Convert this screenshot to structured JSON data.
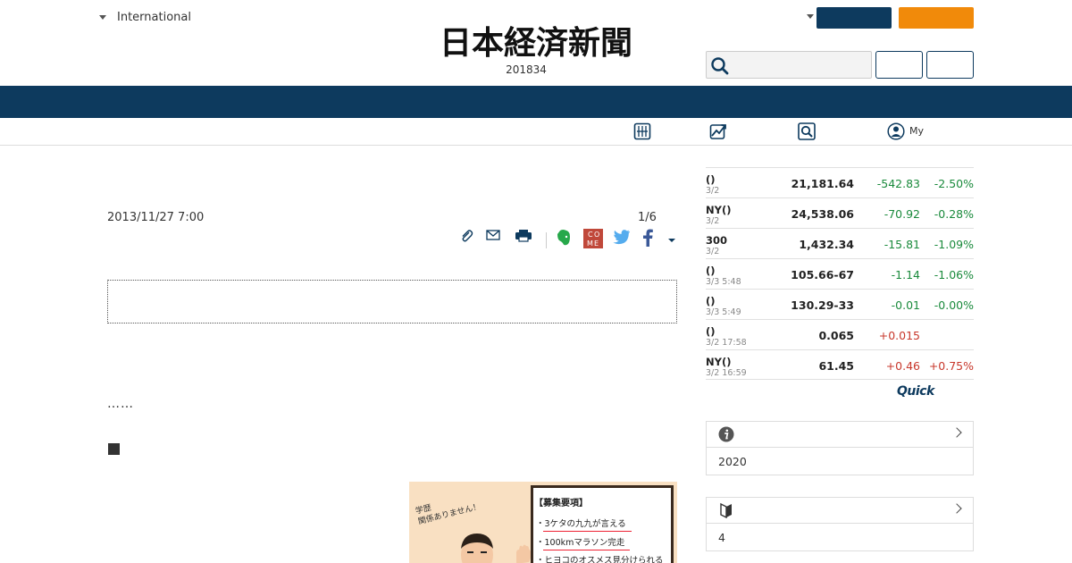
{
  "header": {
    "edition_label": "International",
    "logo_text": "日本経済新聞",
    "logo_sub": "201834"
  },
  "subnav": {
    "my_label": "My"
  },
  "article": {
    "date": "2013/11/27 7:00",
    "page_count": "1/6",
    "ellipsis": "……",
    "ad": {
      "bubble": "学歴\n関係ありません！",
      "title": "【募集要項】",
      "items": [
        "・3ケタの九九が言える",
        "・100kmマラソン完走",
        "・ヒヨコのオスメス見分けられる"
      ]
    }
  },
  "market": {
    "rows": [
      {
        "name": "()",
        "date": "3/2",
        "value": "21,181.64",
        "change": "-542.83",
        "pct": "-2.50%",
        "dir": "neg"
      },
      {
        "name": "NY()",
        "date": "3/2",
        "value": "24,538.06",
        "change": "-70.92",
        "pct": "-0.28%",
        "dir": "neg"
      },
      {
        "name": "300",
        "date": "3/2",
        "value": "1,432.34",
        "change": "-15.81",
        "pct": "-1.09%",
        "dir": "neg"
      },
      {
        "name": "()",
        "date": "3/3 5:48",
        "value": "105.66-67",
        "change": "-1.14",
        "pct": "-1.06%",
        "dir": "neg"
      },
      {
        "name": "()",
        "date": "3/3 5:49",
        "value": "130.29-33",
        "change": "-0.01",
        "pct": "-0.00%",
        "dir": "neg"
      },
      {
        "name": "()",
        "date": "3/2 17:58",
        "value": "0.065",
        "change": "+0.015",
        "pct": "",
        "dir": "pos"
      },
      {
        "name": "NY()",
        "date": "3/2 16:59",
        "value": "61.45",
        "change": "+0.46",
        "pct": "+0.75%",
        "dir": "pos"
      }
    ],
    "quick_logo": "Quick"
  },
  "cards": [
    {
      "icon": "info-icon",
      "text": "2020"
    },
    {
      "icon": "beginner-mark-icon",
      "text": "4"
    }
  ],
  "colors": {
    "navy": "#0d3a5e",
    "orange": "#f18a0a",
    "negative": "#1a8a3c",
    "positive": "#c8382c"
  }
}
